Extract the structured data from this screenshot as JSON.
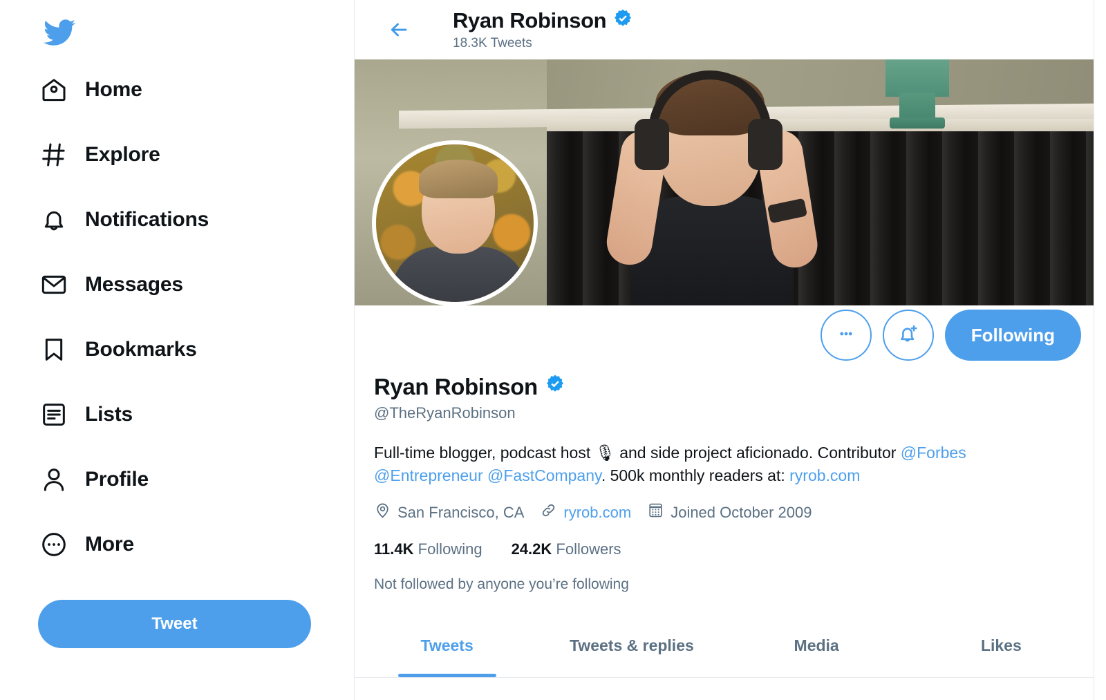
{
  "sidebar": {
    "logo_icon": "twitter-bird-icon",
    "items": [
      {
        "label": "Home",
        "icon": "home-icon"
      },
      {
        "label": "Explore",
        "icon": "hashtag-icon"
      },
      {
        "label": "Notifications",
        "icon": "bell-icon"
      },
      {
        "label": "Messages",
        "icon": "envelope-icon"
      },
      {
        "label": "Bookmarks",
        "icon": "bookmark-icon"
      },
      {
        "label": "Lists",
        "icon": "list-icon"
      },
      {
        "label": "Profile",
        "icon": "person-icon"
      },
      {
        "label": "More",
        "icon": "more-circle-icon"
      }
    ],
    "tweet_button": "Tweet"
  },
  "header": {
    "back_icon": "back-arrow-icon",
    "title": "Ryan Robinson",
    "verified_icon": "verified-badge-icon",
    "tweet_count": "18.3K Tweets"
  },
  "profile": {
    "banner_alt": "profile-banner-image",
    "avatar_alt": "profile-avatar-image",
    "name": "Ryan Robinson",
    "verified_icon": "verified-badge-icon",
    "handle": "@TheRyanRobinson",
    "bio": {
      "line1_a": "Full-time blogger, podcast host ",
      "mic_icon": "🎙",
      "line1_b": " and side project aficionado. Contributor ",
      "mention_forbes": "@Forbes",
      "mention_entrepreneur": "@Entrepreneur",
      "mention_fastcompany": "@FastCompany",
      "line2_b": ". 500k monthly readers at: ",
      "bio_link": "ryrob.com"
    },
    "meta": {
      "location_icon": "location-pin-icon",
      "location": "San Francisco, CA",
      "link_icon": "link-chain-icon",
      "website": "ryrob.com",
      "calendar_icon": "calendar-icon",
      "joined": "Joined October 2009"
    },
    "stats": {
      "following_count": "11.4K",
      "following_label": "Following",
      "followers_count": "24.2K",
      "followers_label": "Followers"
    },
    "not_followed": "Not followed by anyone you’re following"
  },
  "actions": {
    "more_icon": "more-dots-icon",
    "more_label": "More",
    "notify_icon": "bell-plus-icon",
    "notify_label": "Notify",
    "follow_state": "Following"
  },
  "tabs": [
    {
      "label": "Tweets",
      "active": true
    },
    {
      "label": "Tweets & replies",
      "active": false
    },
    {
      "label": "Media",
      "active": false
    },
    {
      "label": "Likes",
      "active": false
    }
  ],
  "colors": {
    "twitter_blue": "#4d9fec",
    "text_primary": "#0f1419",
    "text_secondary": "#5b7083",
    "border": "#e8eaed"
  }
}
